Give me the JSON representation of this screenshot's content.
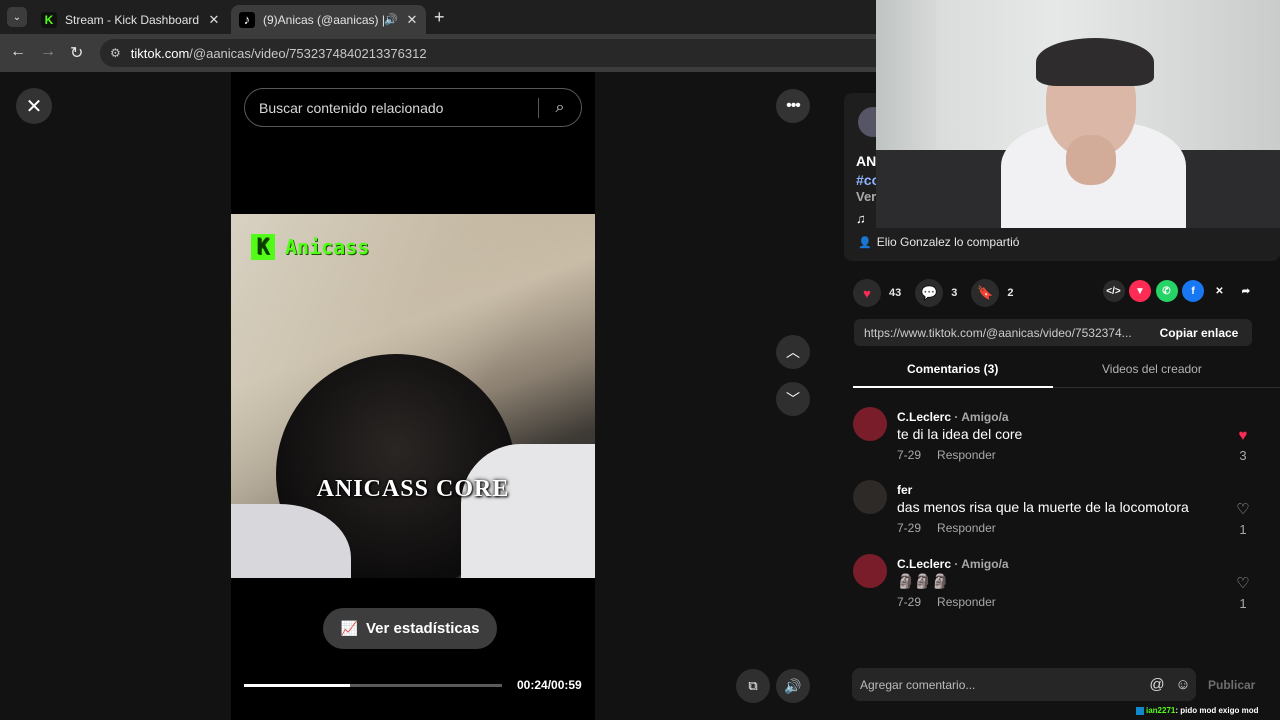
{
  "browser": {
    "tabs": [
      {
        "title": "Stream - Kick Dashboard",
        "favicon": "kick-logo"
      },
      {
        "title": "(9)Anicas (@aanicas) | TikTo",
        "favicon": "tiktok-logo"
      }
    ],
    "url_host": "tiktok.com",
    "url_path": "/@aanicas/video/7532374840213376312"
  },
  "player": {
    "search_placeholder": "Buscar contenido relacionado",
    "overlay_channel": "Anicass",
    "caption": "ANICASS CORE",
    "stats_button": "Ver estadísticas",
    "time": "00:24/00:59",
    "progress": 0.41
  },
  "description": {
    "name_fragment": "AN",
    "tag_fragment": "#cc",
    "more_fragment": "Ver",
    "shared_by": "Elio Gonzalez lo compartió"
  },
  "actions": {
    "likes": "43",
    "comments": "3",
    "saves": "2"
  },
  "share_icons": [
    {
      "name": "embed-icon",
      "glyph": "</>",
      "color": "#2b2b2b"
    },
    {
      "name": "send-icon",
      "glyph": "▼",
      "color": "#fe2c55"
    },
    {
      "name": "whatsapp-icon",
      "glyph": "✆",
      "color": "#25d366"
    },
    {
      "name": "facebook-icon",
      "glyph": "f",
      "color": "#1877f2"
    },
    {
      "name": "x-icon",
      "glyph": "✕",
      "color": "#121212"
    },
    {
      "name": "share-arrow-icon",
      "glyph": "➦",
      "color": "#121212"
    }
  ],
  "link": {
    "url": "https://www.tiktok.com/@aanicas/video/7532374...",
    "copy_label": "Copiar enlace"
  },
  "tabs": {
    "comments": "Comentarios (3)",
    "creator_videos": "Videos del creador"
  },
  "comments": [
    {
      "user": "C.Leclerc",
      "relation": " · Amigo/a",
      "text": "te di la idea del core",
      "date": "7-29",
      "reply": "Responder",
      "likes": "3",
      "liked": true
    },
    {
      "user": "fer",
      "relation": "",
      "text": "das menos risa que la muerte de la locomotora",
      "date": "7-29",
      "reply": "Responder",
      "likes": "1",
      "liked": false
    },
    {
      "user": "C.Leclerc",
      "relation": " · Amigo/a",
      "text": "🗿🗿🗿",
      "date": "7-29",
      "reply": "Responder",
      "likes": "1",
      "liked": false
    }
  ],
  "composer": {
    "placeholder": "Agregar comentario...",
    "publish": "Publicar"
  },
  "chat": {
    "user": "ian2271",
    "message": ": pido mod exigo mod"
  },
  "colors": {
    "kick_green": "#53fc18",
    "tiktok_red": "#fe2c55"
  }
}
